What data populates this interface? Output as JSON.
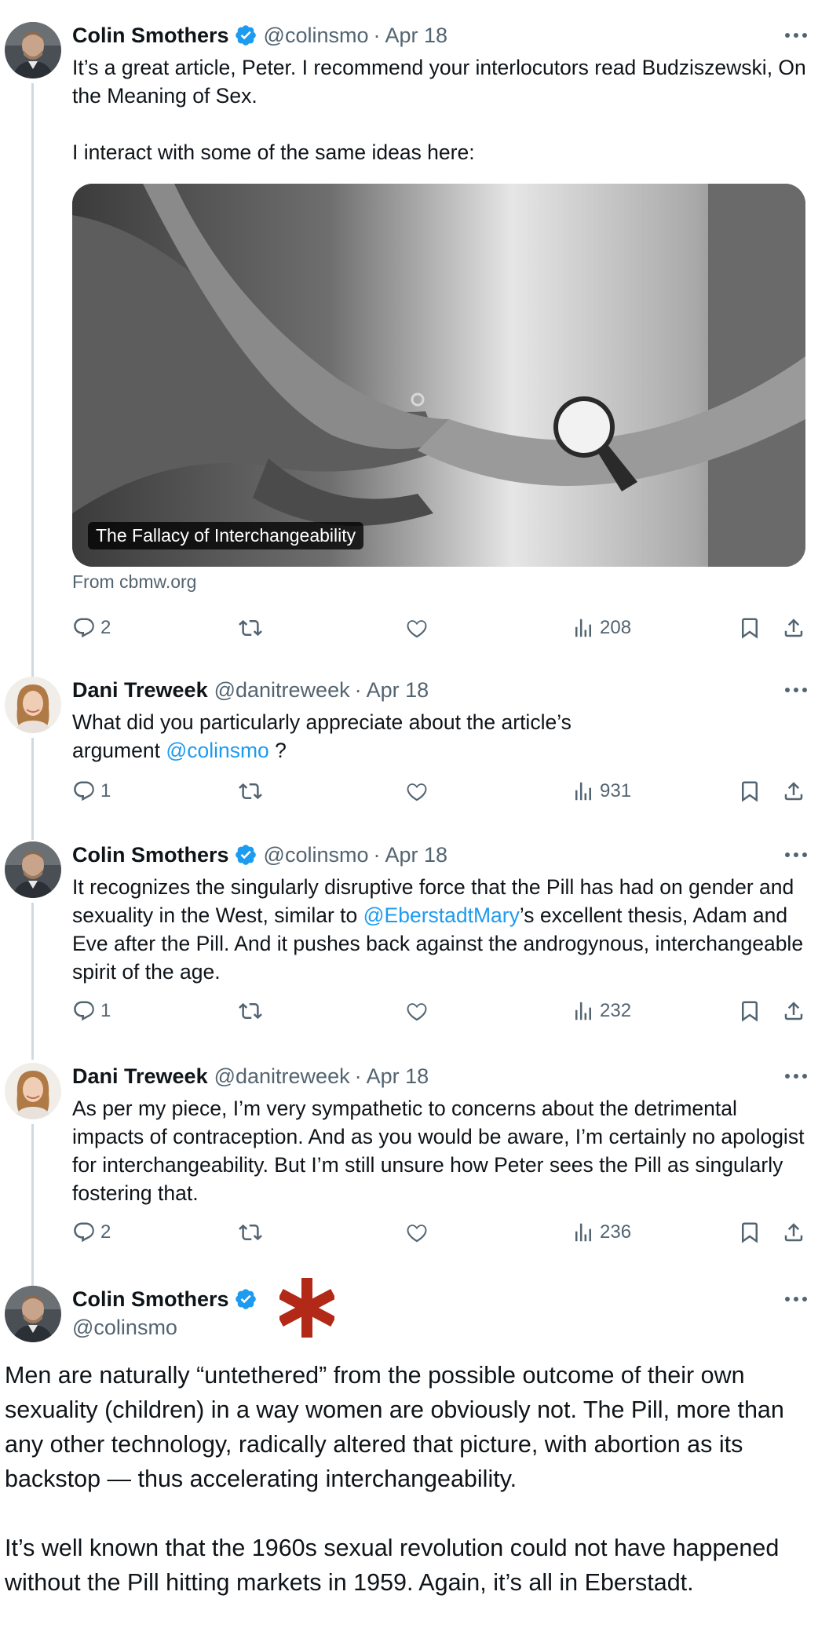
{
  "tweets": [
    {
      "name": "Colin Smothers",
      "handle": "@colinsmo",
      "date": "Apr 18",
      "text": "It’s a great article, Peter. I recommend your interlocutors read Budziszewski, On the Meaning of Sex.\n\nI interact with some of the same ideas here:",
      "card": {
        "title": "The Fallacy of Interchangeability",
        "source": "From cbmw.org"
      },
      "replies": "2",
      "views": "208"
    },
    {
      "name": "Dani Treweek",
      "handle": "@danitreweek",
      "date": "Apr 18",
      "text_before": "What did you particularly appreciate about the article’s argument",
      "mention": "@colinsmo",
      "text_after": " ?",
      "replies": "1",
      "views": "931"
    },
    {
      "name": "Colin Smothers",
      "handle": "@colinsmo",
      "date": "Apr 18",
      "text_before": "It recognizes the singularly disruptive force that the Pill has had on gender and sexuality in the West, similar to ",
      "mention": "@EberstadtMary",
      "text_after": "’s excellent thesis, Adam and Eve after the Pill. And it pushes back against the androgynous, interchangeable spirit of the age.",
      "replies": "1",
      "views": "232"
    },
    {
      "name": "Dani Treweek",
      "handle": "@danitreweek",
      "date": "Apr 18",
      "text": "As per my piece, I’m very sympathetic to concerns about the detrimental impacts of contraception. And as you would be aware, I’m certainly no apologist for interchangeability. But I’m still unsure how  Peter sees the Pill as singularly fostering  that.",
      "replies": "2",
      "views": "236"
    }
  ],
  "main_tweet": {
    "name": "Colin Smothers",
    "handle": "@colinsmo",
    "text": "Men are naturally “untethered” from the possible outcome of their own sexuality (children) in a way women are obviously not. The Pill, more than any other technology, radically altered that picture, with abortion as its backstop — thus accelerating interchangeability.\n\nIt’s well known that the 1960s sexual revolution could not have happened without the Pill hitting markets in 1959. Again, it’s all in Eberstadt."
  },
  "colors": {
    "text": "#0f1419",
    "secondary": "#536471",
    "link": "#1d9bf0",
    "verified": "#1d9bf0",
    "asterisk": "#b22a17"
  },
  "icons": [
    "reply-icon",
    "retweet-icon",
    "like-icon",
    "views-icon",
    "bookmark-icon",
    "share-icon",
    "verified-badge-icon",
    "more-icon"
  ]
}
